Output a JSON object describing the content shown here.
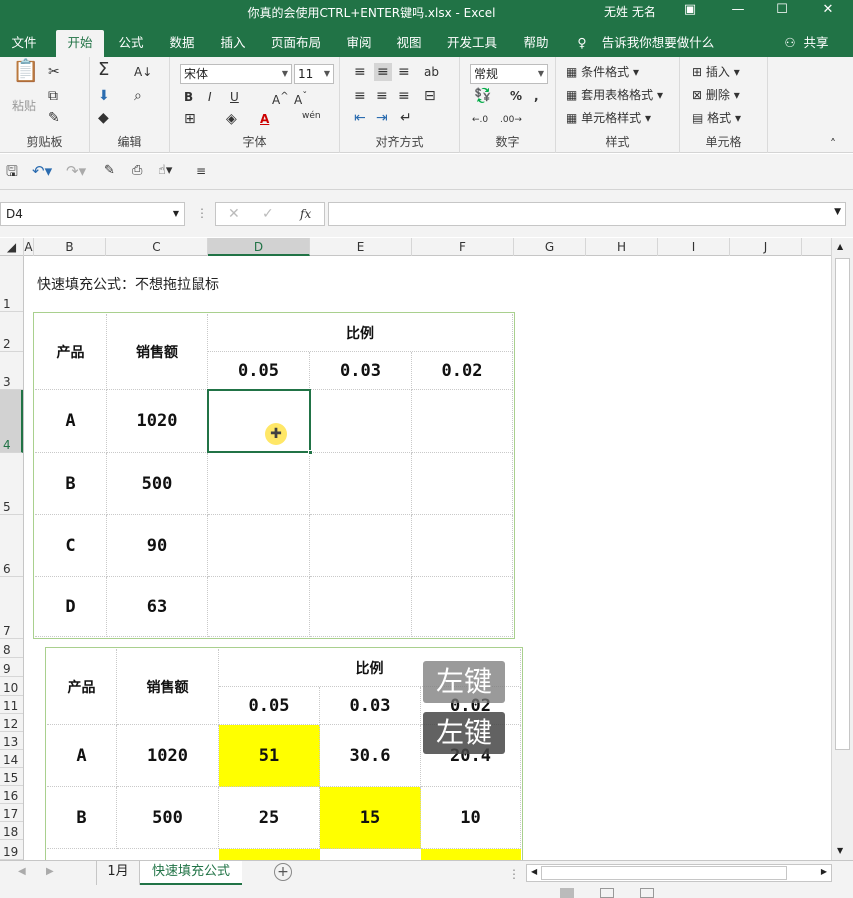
{
  "window": {
    "title": "你真的会使用CTRL+ENTER键吗.xlsx  -  Excel",
    "user": "无姓 无名"
  },
  "ribbon_tabs": [
    "文件",
    "开始",
    "公式",
    "数据",
    "插入",
    "页面布局",
    "审阅",
    "视图",
    "开发工具",
    "帮助"
  ],
  "tell_me": "告诉我你想要做什么",
  "share": "共享",
  "ribbon": {
    "clipboard": {
      "paste": "粘贴",
      "label": "剪贴板"
    },
    "editing": {
      "label": "编辑"
    },
    "font": {
      "name": "宋体",
      "size": "11",
      "label": "字体",
      "wen": "wén"
    },
    "alignment": {
      "label": "对齐方式"
    },
    "number": {
      "format": "常规",
      "label": "数字",
      "pct": "%"
    },
    "styles": {
      "conditional": "条件格式",
      "table": "套用表格格式",
      "cell": "单元格样式",
      "label": "样式"
    },
    "cells": {
      "insert": "插入",
      "delete": "删除",
      "format": "格式",
      "label": "单元格"
    }
  },
  "formula_bar": {
    "name_box": "D4",
    "formula": "",
    "fx": "fx"
  },
  "columns": [
    "A",
    "B",
    "C",
    "D",
    "E",
    "F",
    "G",
    "H",
    "I",
    "J"
  ],
  "rows": [
    "1",
    "2",
    "3",
    "4",
    "5",
    "6",
    "7",
    "8",
    "9",
    "10",
    "11",
    "12",
    "13",
    "14",
    "15",
    "16",
    "17",
    "18",
    "19"
  ],
  "sheet": {
    "heading": "快速填充公式：不想拖拉鼠标",
    "table1": {
      "h_product": "产品",
      "h_sales": "销售额",
      "h_ratio": "比例",
      "ratios": [
        "0.05",
        "0.03",
        "0.02"
      ],
      "rows": [
        {
          "product": "A",
          "sales": "1020"
        },
        {
          "product": "B",
          "sales": "500"
        },
        {
          "product": "C",
          "sales": "90"
        },
        {
          "product": "D",
          "sales": "63"
        }
      ]
    },
    "table2": {
      "h_product": "产品",
      "h_sales": "销售额",
      "h_ratio": "比例",
      "ratios": [
        "0.05",
        "0.03",
        "0.02"
      ],
      "rows": [
        {
          "product": "A",
          "sales": "1020",
          "v": [
            "51",
            "30.6",
            "20.4"
          ]
        },
        {
          "product": "B",
          "sales": "500",
          "v": [
            "25",
            "15",
            "10"
          ]
        }
      ]
    }
  },
  "overlay": {
    "key1": "左键",
    "key2": "左键"
  },
  "sheet_tabs": [
    "1月",
    "快速填充公式"
  ],
  "colors": {
    "accent": "#217346",
    "highlight": "#ffff00"
  }
}
